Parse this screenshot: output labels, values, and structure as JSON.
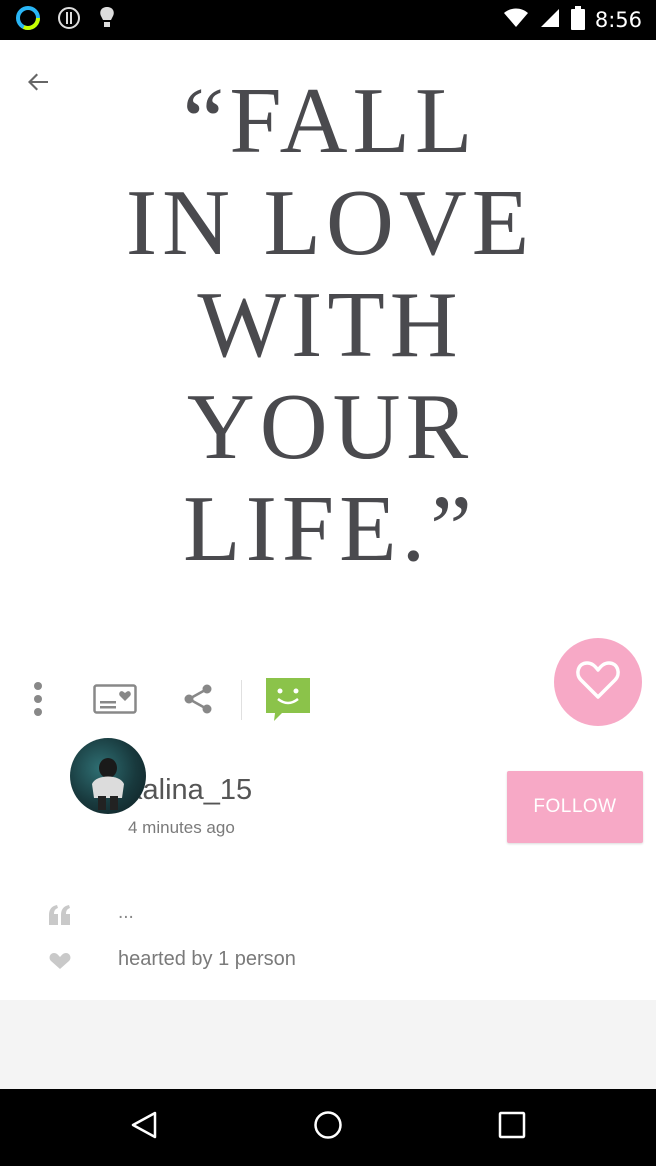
{
  "status_bar": {
    "time": "8:56",
    "left_icons": [
      "ring-app-icon",
      "info-circle-icon",
      "lightbulb-icon"
    ],
    "right_icons": [
      "wifi-icon",
      "cellular-signal-icon",
      "battery-icon"
    ]
  },
  "post": {
    "quote_image_text": "“FALL\nIN LOVE\nWITH\nYOUR\nLIFE.”",
    "author": "kalina_15",
    "time_ago": "4 minutes ago",
    "caption": "...",
    "hearted_by": "hearted by 1 person"
  },
  "actions": {
    "follow_label": "FOLLOW"
  },
  "colors": {
    "accent_pink": "#f7a9c6",
    "chat_green": "#8bc34a",
    "status_bar": "#000000",
    "nav_bar": "#000000"
  }
}
